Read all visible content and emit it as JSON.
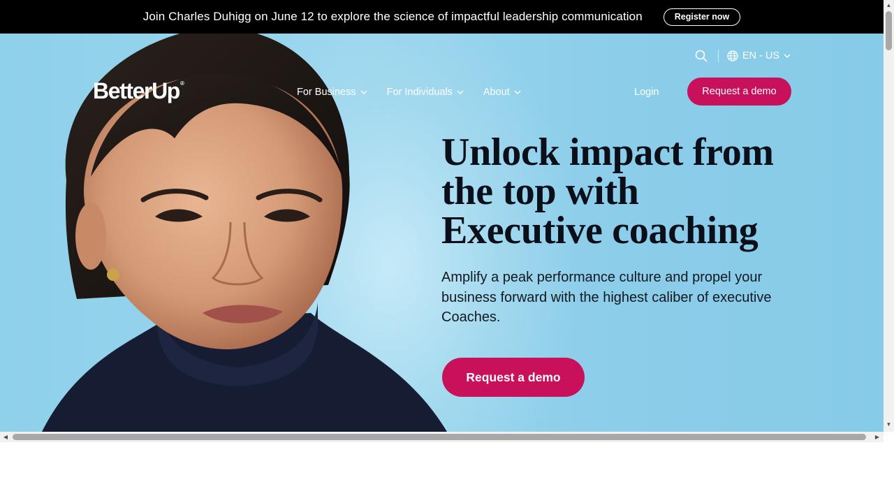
{
  "announcement": {
    "text": "Join Charles Duhigg on June 12 to explore the science of impactful leadership communication",
    "button_label": "Register now"
  },
  "utility": {
    "search_icon": "search-icon",
    "language": "EN - US"
  },
  "header": {
    "logo_text": "BetterUp",
    "logo_mark": "®",
    "nav": [
      {
        "label": "For Business"
      },
      {
        "label": "For Individuals"
      },
      {
        "label": "About"
      }
    ],
    "login_label": "Login",
    "cta_label": "Request a demo"
  },
  "hero": {
    "headline_lines": [
      "Unlock impact from",
      "the top with",
      "Executive coaching"
    ],
    "subcopy": "Amplify a peak performance culture and propel your business forward with the highest caliber of executive Coaches.",
    "cta_label": "Request a demo",
    "image": "portrait-photo"
  },
  "colors": {
    "brand_accent": "#c8115a",
    "hero_background": "#8fd0ea",
    "announcement_background": "#000000"
  }
}
